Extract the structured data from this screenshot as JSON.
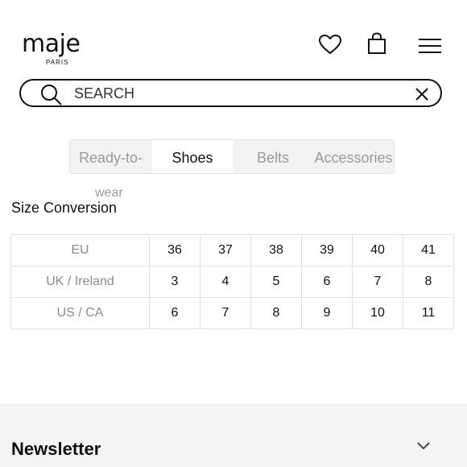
{
  "brand": {
    "name": "maje",
    "sub": "PARIS"
  },
  "header": {
    "icons": [
      "heart-icon",
      "shopping-bag-icon",
      "menu-icon"
    ]
  },
  "search": {
    "placeholder": "SEARCH",
    "value": ""
  },
  "tabs": [
    {
      "label_line1": "Ready-to-",
      "label_line2": "wear",
      "active": false
    },
    {
      "label": "Shoes",
      "active": true
    },
    {
      "label": "Belts",
      "active": false
    },
    {
      "label": "Accessories",
      "active": false
    }
  ],
  "size_conversion": {
    "title": "Size Conversion",
    "rows": [
      {
        "label": "EU",
        "values": [
          "36",
          "37",
          "38",
          "39",
          "40",
          "41"
        ]
      },
      {
        "label": "UK / Ireland",
        "values": [
          "3",
          "4",
          "5",
          "6",
          "7",
          "8"
        ]
      },
      {
        "label": "US / CA",
        "values": [
          "6",
          "7",
          "8",
          "9",
          "10",
          "11"
        ]
      }
    ]
  },
  "newsletter": {
    "title": "Newsletter"
  },
  "colors": {
    "text": "#111111",
    "muted": "#9a9a9a",
    "tab_bg": "#f2f2f2",
    "border": "#e1e1e1"
  }
}
